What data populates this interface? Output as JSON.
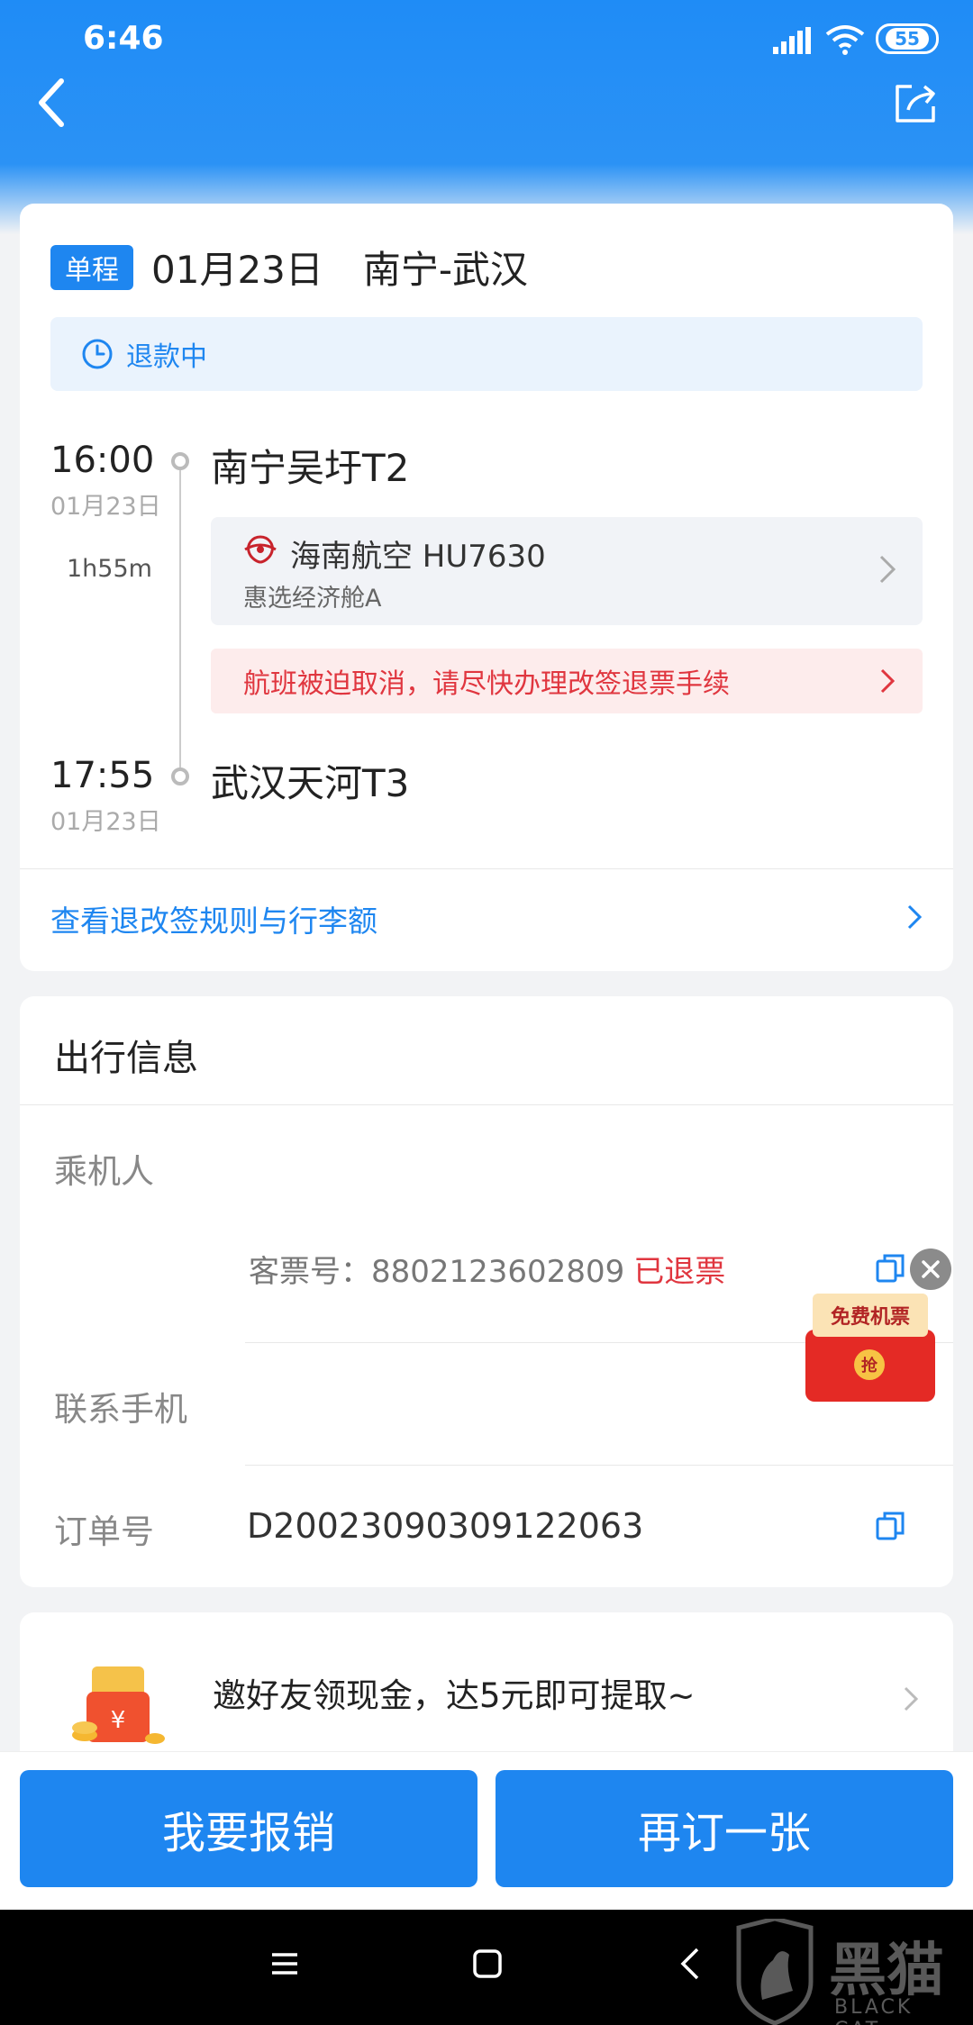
{
  "status_bar": {
    "time": "6:46",
    "battery": "55"
  },
  "trip": {
    "type_tag": "单程",
    "date": "01月23日",
    "route": "南宁-武汉",
    "refund_status": "退款中",
    "departure": {
      "time": "16:00",
      "date": "01月23日",
      "airport": "南宁吴圩T2"
    },
    "duration": "1h55m",
    "arrival": {
      "time": "17:55",
      "date": "01月23日",
      "airport": "武汉天河T3"
    },
    "flight": {
      "airline": "海南航空 HU7630",
      "cabin": "惠选经济舱A"
    },
    "cancel_notice": "航班被迫取消，请尽快办理改签退票手续",
    "rules_link": "查看退改签规则与行李额"
  },
  "travel_info": {
    "title": "出行信息",
    "passenger_label": "乘机人",
    "ticket_label": "客票号：",
    "ticket_number": "8802123602809",
    "ticket_status": "已退票",
    "phone_label": "联系手机",
    "order_label": "订单号",
    "order_number": "D20023090309122063"
  },
  "promo_float": {
    "title": "免费机票",
    "button": "抢"
  },
  "invite": {
    "text": "邀好友领现金，达5元即可提取~"
  },
  "actions": {
    "reimburse": "我要报销",
    "rebook": "再订一张"
  },
  "watermark": {
    "cn": "黑猫",
    "en": "BLACK CAT"
  },
  "colors": {
    "primary": "#1e86f0",
    "danger": "#e0363f",
    "header": "#2b92f5"
  }
}
